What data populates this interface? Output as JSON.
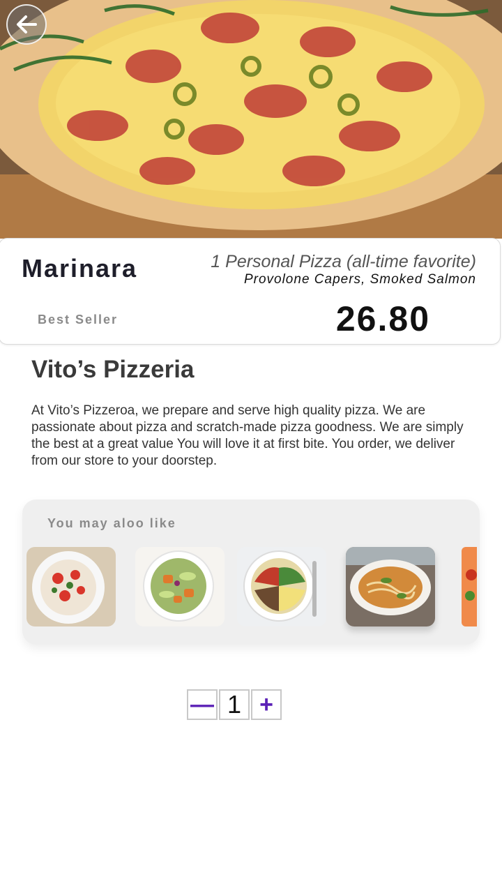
{
  "header": {
    "back_icon": "arrow-left-icon"
  },
  "product": {
    "name": "Marinara",
    "subtitle": "1 Personal Pizza (all-time favorite)",
    "toppings": "Provolone Capers, Smoked Salmon",
    "badge": "Best Seller",
    "price": "26.80"
  },
  "store": {
    "name": "Vito’s Pizzeria",
    "description": "At Vito’s Pizzeroa, we prepare and serve high quality pizza. We are passionate  about pizza and scratch-made pizza goodness.  We are simply the best at a great value You will love it at first bite. You order, we deliver from our store to your doorstep."
  },
  "recommendations": {
    "title": "You may aloo like",
    "items": [
      {
        "icon": "salad-plate-image"
      },
      {
        "icon": "avocado-salad-image"
      },
      {
        "icon": "grain-bowl-image"
      },
      {
        "icon": "noodle-soup-image"
      },
      {
        "icon": "partial-dish-image"
      }
    ]
  },
  "quantity": {
    "decrement": "—",
    "value": "1",
    "increment": "+"
  },
  "colors": {
    "accent": "#5b21b6",
    "text": "#333333"
  }
}
